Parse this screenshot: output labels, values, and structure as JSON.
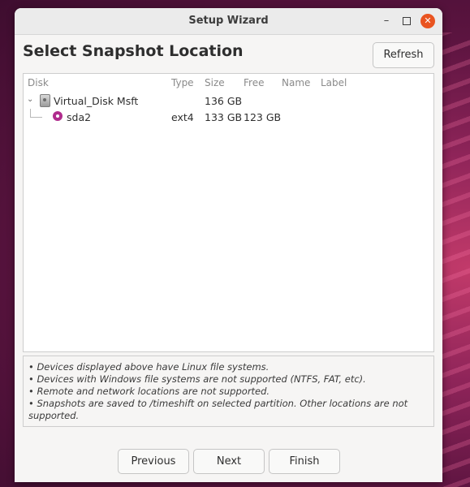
{
  "window": {
    "title": "Setup Wizard"
  },
  "heading": "Select Snapshot Location",
  "refresh_label": "Refresh",
  "columns": [
    "Disk",
    "Type",
    "Size",
    "Free",
    "Name",
    "Label"
  ],
  "rows": [
    {
      "name": "Virtual_Disk Msft",
      "type": "",
      "size": "136 GB",
      "free": "",
      "label_name": "",
      "label": "",
      "icon": "hard-disk-icon",
      "expanded": true
    },
    {
      "name": "sda2",
      "type": "ext4",
      "size": "133 GB",
      "free": "123 GB",
      "label_name": "",
      "label": "",
      "icon": "partition-icon"
    }
  ],
  "notes": [
    "• Devices displayed above have Linux file systems.",
    "• Devices with Windows file systems are not supported (NTFS, FAT, etc).",
    "• Remote and network locations are not supported.",
    "• Snapshots are saved to /timeshift on selected partition. Other locations are not supported."
  ],
  "buttons": {
    "previous": "Previous",
    "next": "Next",
    "finish": "Finish"
  },
  "colors": {
    "accent": "#e95420",
    "partition": "#b02c8d"
  }
}
